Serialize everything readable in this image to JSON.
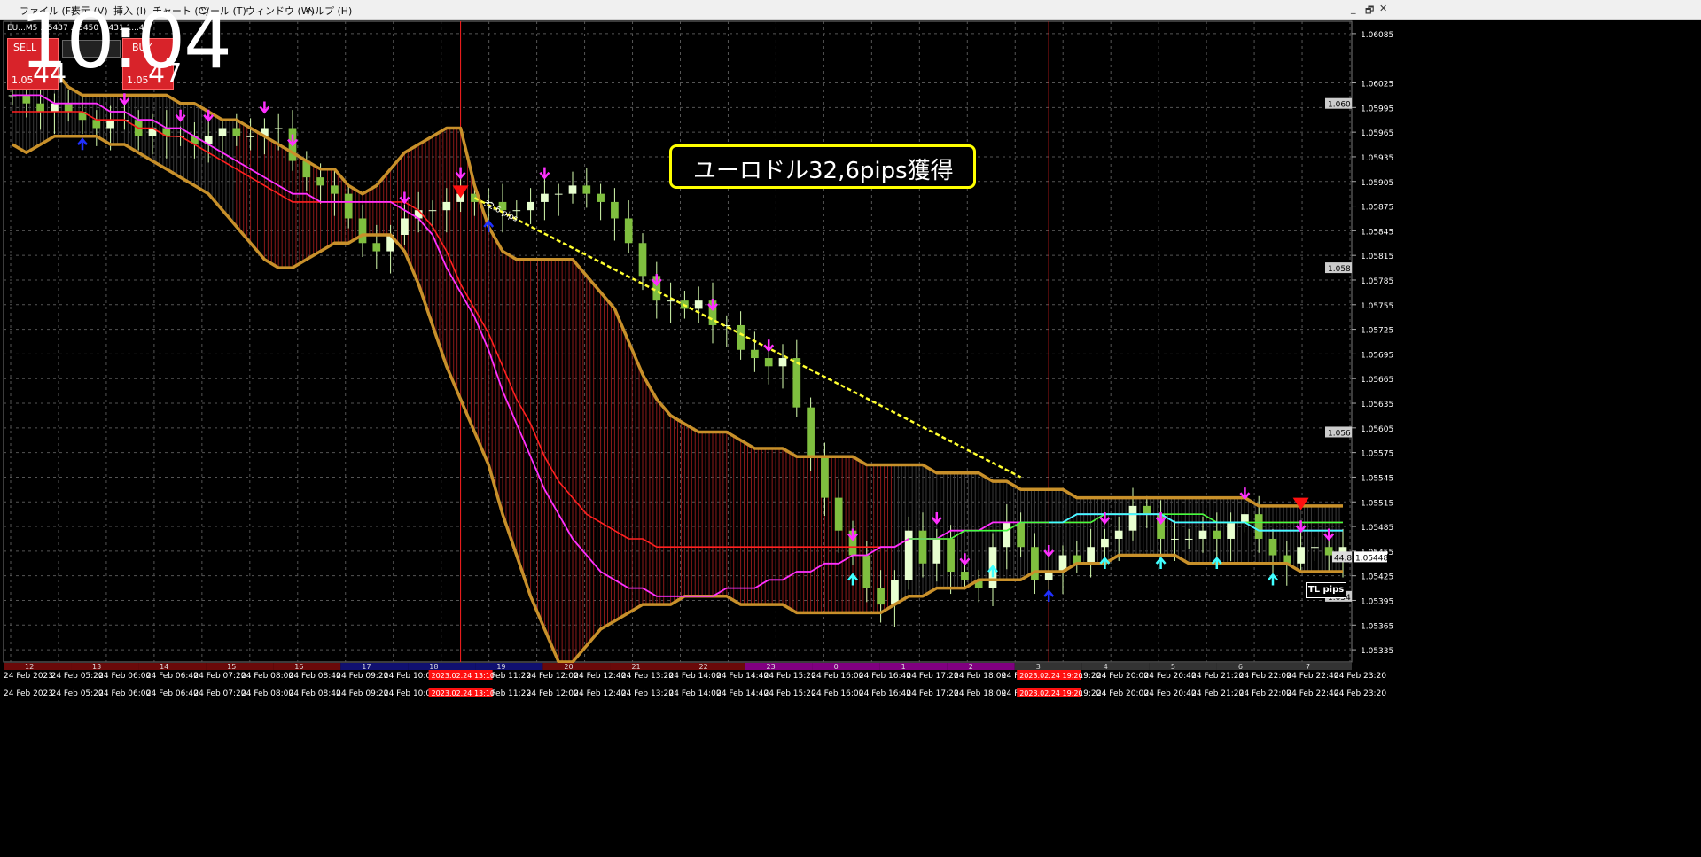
{
  "menu": {
    "items": [
      "ファイル (F)",
      "表示 (V)",
      "挿入 (I)",
      "チャート (C)",
      "ツール (T)",
      "ウィンドウ (W)",
      "ヘルプ (H)"
    ],
    "window_controls": [
      "_",
      "🗗",
      "✕"
    ]
  },
  "clock": "10:04",
  "symbol_label": "EU...M5 ...5437 ...5450 ...431 1...48",
  "trade_panel": {
    "sell_label": "SELL",
    "buy_label": "BUY",
    "sell_prefix": "1.05",
    "sell_big": "44",
    "buy_prefix": "1.05",
    "buy_big": "47",
    "buy_sup": "0"
  },
  "annotation": {
    "text": "ユーロドル32,6pips獲得",
    "trendline_label": "32.6 pips",
    "tl_button": "TL pips"
  },
  "chart_data": {
    "type": "candlestick",
    "instrument": "EURUSD M5",
    "price_axis_ticks": [
      "1.06085",
      "1.06025",
      "1.05995",
      "1.05965",
      "1.05935",
      "1.05905",
      "1.05875",
      "1.05845",
      "1.05815",
      "1.05785",
      "1.05755",
      "1.05725",
      "1.05695",
      "1.05665",
      "1.05635",
      "1.05605",
      "1.05575",
      "1.05545",
      "1.05515",
      "1.05485",
      "1.05455",
      "1.05425",
      "1.05395",
      "1.05365",
      "1.05335"
    ],
    "price_axis_badges": [
      "1.060",
      "1.058",
      "1.056",
      "1.054"
    ],
    "current_price": "1.05448",
    "current_price_badge": "44.8",
    "ylim": [
      1.0532,
      1.061
    ],
    "time_labels": [
      "24 Feb 2023",
      "24 Feb 05:20",
      "24 Feb 06:00",
      "24 Feb 06:40",
      "24 Feb 07:20",
      "24 Feb 08:00",
      "24 Feb 08:40",
      "24 Feb 09:20",
      "24 Feb 10:00",
      "24 Feb 10:40",
      "24 Feb 11:20",
      "24 Feb 12:00",
      "24 Feb 12:40",
      "24 Feb 13:20",
      "24 Feb 14:00",
      "24 Feb 14:40",
      "24 Feb 15:20",
      "24 Feb 16:00",
      "24 Feb 16:40",
      "24 Feb 17:20",
      "24 Feb 18:00",
      "24 Feb 18:40",
      "24 Feb 19:20",
      "24 Feb 20:00",
      "24 Feb 20:40",
      "24 Feb 21:20",
      "24 Feb 22:00",
      "24 Feb 22:40",
      "24 Feb 23:20"
    ],
    "session_labels": [
      "12",
      "13",
      "14",
      "15",
      "16",
      "17",
      "18",
      "19",
      "20",
      "21",
      "22",
      "23",
      "0",
      "1",
      "2",
      "3",
      "4",
      "5",
      "6",
      "7"
    ],
    "highlight_times": [
      "2023.02.24 13:10",
      "2023.02.24 19:20"
    ],
    "closes": [
      1.0601,
      1.06,
      1.0599,
      1.06,
      1.0599,
      1.0598,
      1.0597,
      1.0598,
      1.0598,
      1.0596,
      1.0597,
      1.0596,
      1.0596,
      1.0595,
      1.0596,
      1.0597,
      1.0596,
      1.0596,
      1.0597,
      1.0597,
      1.0593,
      1.0591,
      1.059,
      1.0589,
      1.0586,
      1.0583,
      1.0582,
      1.0584,
      1.0586,
      1.0587,
      1.0587,
      1.0588,
      1.0589,
      1.0588,
      1.0588,
      1.0587,
      1.0587,
      1.0588,
      1.0589,
      1.0589,
      1.059,
      1.0589,
      1.0588,
      1.0586,
      1.0583,
      1.0579,
      1.0576,
      1.0576,
      1.0575,
      1.0576,
      1.0573,
      1.0573,
      1.057,
      1.0569,
      1.0568,
      1.0569,
      1.0563,
      1.0557,
      1.0552,
      1.0548,
      1.0545,
      1.0541,
      1.0539,
      1.0542,
      1.0548,
      1.0544,
      1.0547,
      1.0543,
      1.0542,
      1.0541,
      1.0546,
      1.0549,
      1.0546,
      1.0542,
      1.0543,
      1.0545,
      1.0544,
      1.0546,
      1.0547,
      1.0548,
      1.0551,
      1.055,
      1.0547,
      1.0547,
      1.0547,
      1.0548,
      1.0547,
      1.0549,
      1.055,
      1.0547,
      1.0545,
      1.0544,
      1.0546,
      1.0546,
      1.0545,
      1.0546
    ],
    "series": [
      {
        "name": "Bollinger Upper",
        "values": [
          1.0603,
          1.0604,
          1.0604,
          1.0604,
          1.0602,
          1.0601,
          1.0601,
          1.0601,
          1.0601,
          1.0601,
          1.0601,
          1.0601,
          1.06,
          1.06,
          1.0599,
          1.0598,
          1.0598,
          1.0597,
          1.0596,
          1.0595,
          1.0594,
          1.0593,
          1.0592,
          1.0592,
          1.059,
          1.0589,
          1.059,
          1.0592,
          1.0594,
          1.0595,
          1.0596,
          1.0597,
          1.0597,
          1.059,
          1.0585,
          1.0582,
          1.0581,
          1.0581,
          1.0581,
          1.0581,
          1.0581,
          1.0579,
          1.0577,
          1.0575,
          1.0571,
          1.0567,
          1.0564,
          1.0562,
          1.0561,
          1.056,
          1.056,
          1.056,
          1.0559,
          1.0558,
          1.0558,
          1.0558,
          1.0557,
          1.0557,
          1.0557,
          1.0557,
          1.0557,
          1.0556,
          1.0556,
          1.0556,
          1.0556,
          1.0556,
          1.0555,
          1.0555,
          1.0555,
          1.0555,
          1.0554,
          1.0554,
          1.0553,
          1.0553,
          1.0553,
          1.0553,
          1.0552,
          1.0552,
          1.0552,
          1.0552,
          1.0552,
          1.0552,
          1.0552,
          1.0552,
          1.0552,
          1.0552,
          1.0552,
          1.0552,
          1.0552,
          1.0551,
          1.0551,
          1.0551,
          1.0551,
          1.0551,
          1.0551,
          1.0551
        ]
      },
      {
        "name": "Bollinger Lower",
        "values": [
          1.0595,
          1.0594,
          1.0595,
          1.0596,
          1.0596,
          1.0596,
          1.0596,
          1.0595,
          1.0595,
          1.0594,
          1.0593,
          1.0592,
          1.0591,
          1.059,
          1.0589,
          1.0587,
          1.0585,
          1.0583,
          1.0581,
          1.058,
          1.058,
          1.0581,
          1.0582,
          1.0583,
          1.0583,
          1.0584,
          1.0584,
          1.0584,
          1.0582,
          1.0578,
          1.0573,
          1.0568,
          1.0564,
          1.056,
          1.0556,
          1.055,
          1.0545,
          1.054,
          1.0536,
          1.0532,
          1.0532,
          1.0534,
          1.0536,
          1.0537,
          1.0538,
          1.0539,
          1.0539,
          1.0539,
          1.054,
          1.054,
          1.054,
          1.054,
          1.0539,
          1.0539,
          1.0539,
          1.0539,
          1.0538,
          1.0538,
          1.0538,
          1.0538,
          1.0538,
          1.0538,
          1.0538,
          1.0539,
          1.054,
          1.054,
          1.0541,
          1.0541,
          1.0541,
          1.0542,
          1.0542,
          1.0542,
          1.0542,
          1.0543,
          1.0543,
          1.0543,
          1.0544,
          1.0544,
          1.0544,
          1.0545,
          1.0545,
          1.0545,
          1.0545,
          1.0545,
          1.0544,
          1.0544,
          1.0544,
          1.0544,
          1.0544,
          1.0544,
          1.0544,
          1.0544,
          1.0543,
          1.0543,
          1.0543,
          1.0543
        ]
      },
      {
        "name": "MA Red",
        "values": [
          1.0599,
          1.0599,
          1.0599,
          1.0599,
          1.0599,
          1.0599,
          1.0598,
          1.0598,
          1.0598,
          1.0597,
          1.0597,
          1.0596,
          1.0596,
          1.0595,
          1.0594,
          1.0593,
          1.0592,
          1.0591,
          1.059,
          1.0589,
          1.0588,
          1.0588,
          1.0588,
          1.0588,
          1.0588,
          1.0588,
          1.0588,
          1.0588,
          1.0588,
          1.0587,
          1.0585,
          1.0582,
          1.0578,
          1.0575,
          1.0572,
          1.0568,
          1.0564,
          1.0561,
          1.0557,
          1.0554,
          1.0552,
          1.055,
          1.0549,
          1.0548,
          1.0547,
          1.0547,
          1.0546,
          1.0546,
          1.0546,
          1.0546,
          1.0546,
          1.0546,
          1.0546,
          1.0546,
          1.0546,
          1.0546,
          1.0546,
          1.0546,
          1.0546,
          1.0546,
          1.0546,
          1.0546,
          1.0546,
          1.0546,
          1.0547,
          1.0547,
          1.0547,
          1.0547,
          1.0548,
          1.0548,
          1.0548,
          1.0548,
          1.0549,
          1.0549,
          1.0549,
          1.0549,
          1.0549,
          1.0549,
          1.055,
          1.055,
          1.055,
          1.055,
          1.055,
          1.055,
          1.055,
          1.055,
          1.0549,
          1.0549,
          1.0549,
          1.0549,
          1.0549,
          1.0549,
          1.0549,
          1.0549,
          1.0549,
          1.0549
        ]
      },
      {
        "name": "MA Magenta",
        "values": [
          1.0601,
          1.0601,
          1.0601,
          1.06,
          1.06,
          1.06,
          1.06,
          1.0599,
          1.0599,
          1.0598,
          1.0598,
          1.0597,
          1.0597,
          1.0596,
          1.0595,
          1.0594,
          1.0593,
          1.0592,
          1.0591,
          1.059,
          1.0589,
          1.0589,
          1.0588,
          1.0588,
          1.0588,
          1.0588,
          1.0588,
          1.0588,
          1.0587,
          1.0586,
          1.0584,
          1.058,
          1.0577,
          1.0574,
          1.057,
          1.0565,
          1.0561,
          1.0557,
          1.0553,
          1.055,
          1.0547,
          1.0545,
          1.0543,
          1.0542,
          1.0541,
          1.0541,
          1.054,
          1.054,
          1.054,
          1.054,
          1.054,
          1.0541,
          1.0541,
          1.0541,
          1.0542,
          1.0542,
          1.0543,
          1.0543,
          1.0544,
          1.0544,
          1.0545,
          1.0545,
          1.0546,
          1.0546,
          1.0547,
          1.0547,
          1.0547,
          1.0548,
          1.0548,
          1.0548,
          1.0549,
          1.0549,
          1.0549,
          1.0549,
          1.0549,
          1.0549,
          1.055,
          1.055,
          1.055,
          1.055,
          1.055,
          1.055,
          1.055,
          1.0549,
          1.0549,
          1.0549,
          1.0549,
          1.0549,
          1.0549,
          1.0548,
          1.0548,
          1.0548,
          1.0548,
          1.0548,
          1.0548,
          1.0548
        ]
      }
    ],
    "sell_signals_at": [
      8,
      12,
      14,
      18,
      20,
      28,
      32,
      38,
      46,
      50,
      54,
      60,
      66,
      68,
      74,
      78,
      82,
      88,
      92,
      94
    ],
    "buy_signals_at": [
      5,
      34,
      60,
      70,
      74,
      78,
      82,
      86,
      90
    ]
  }
}
